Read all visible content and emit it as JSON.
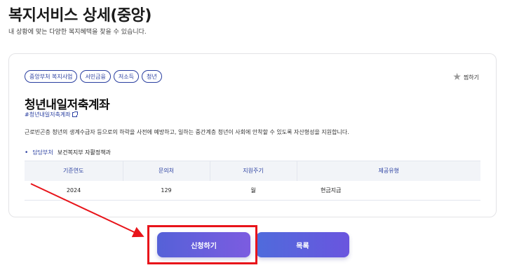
{
  "header": {
    "title": "복지서비스 상세(중앙)",
    "subtitle": "내 상황에 맞는 다양한 복지혜택을 찾을 수 있습니다."
  },
  "card": {
    "tags": [
      "중앙부처 복지사업",
      "서민금융",
      "저소득",
      "청년"
    ],
    "bookmark_label": "찜하기",
    "title": "청년내일저축계좌",
    "hashtag": "#청년내일저축계좌",
    "description": "근로빈곤층 청년의 생계수급자 등으로의 하락을 사전에 예방하고, 일하는 중간계층 청년이 사회에 안착할 수 있도록 자산형성을 지원합니다.",
    "department": {
      "label": "담당부처",
      "value": "보건복지부 자활정책과"
    },
    "table": {
      "headers": [
        "기준연도",
        "문의처",
        "지원주기",
        "제공유형"
      ],
      "row": [
        "2024",
        "129",
        "월",
        "현금지급"
      ]
    }
  },
  "buttons": {
    "apply_label": "신청하기",
    "list_label": "목록"
  },
  "annotation": {
    "highlight_color": "#e8141a"
  }
}
